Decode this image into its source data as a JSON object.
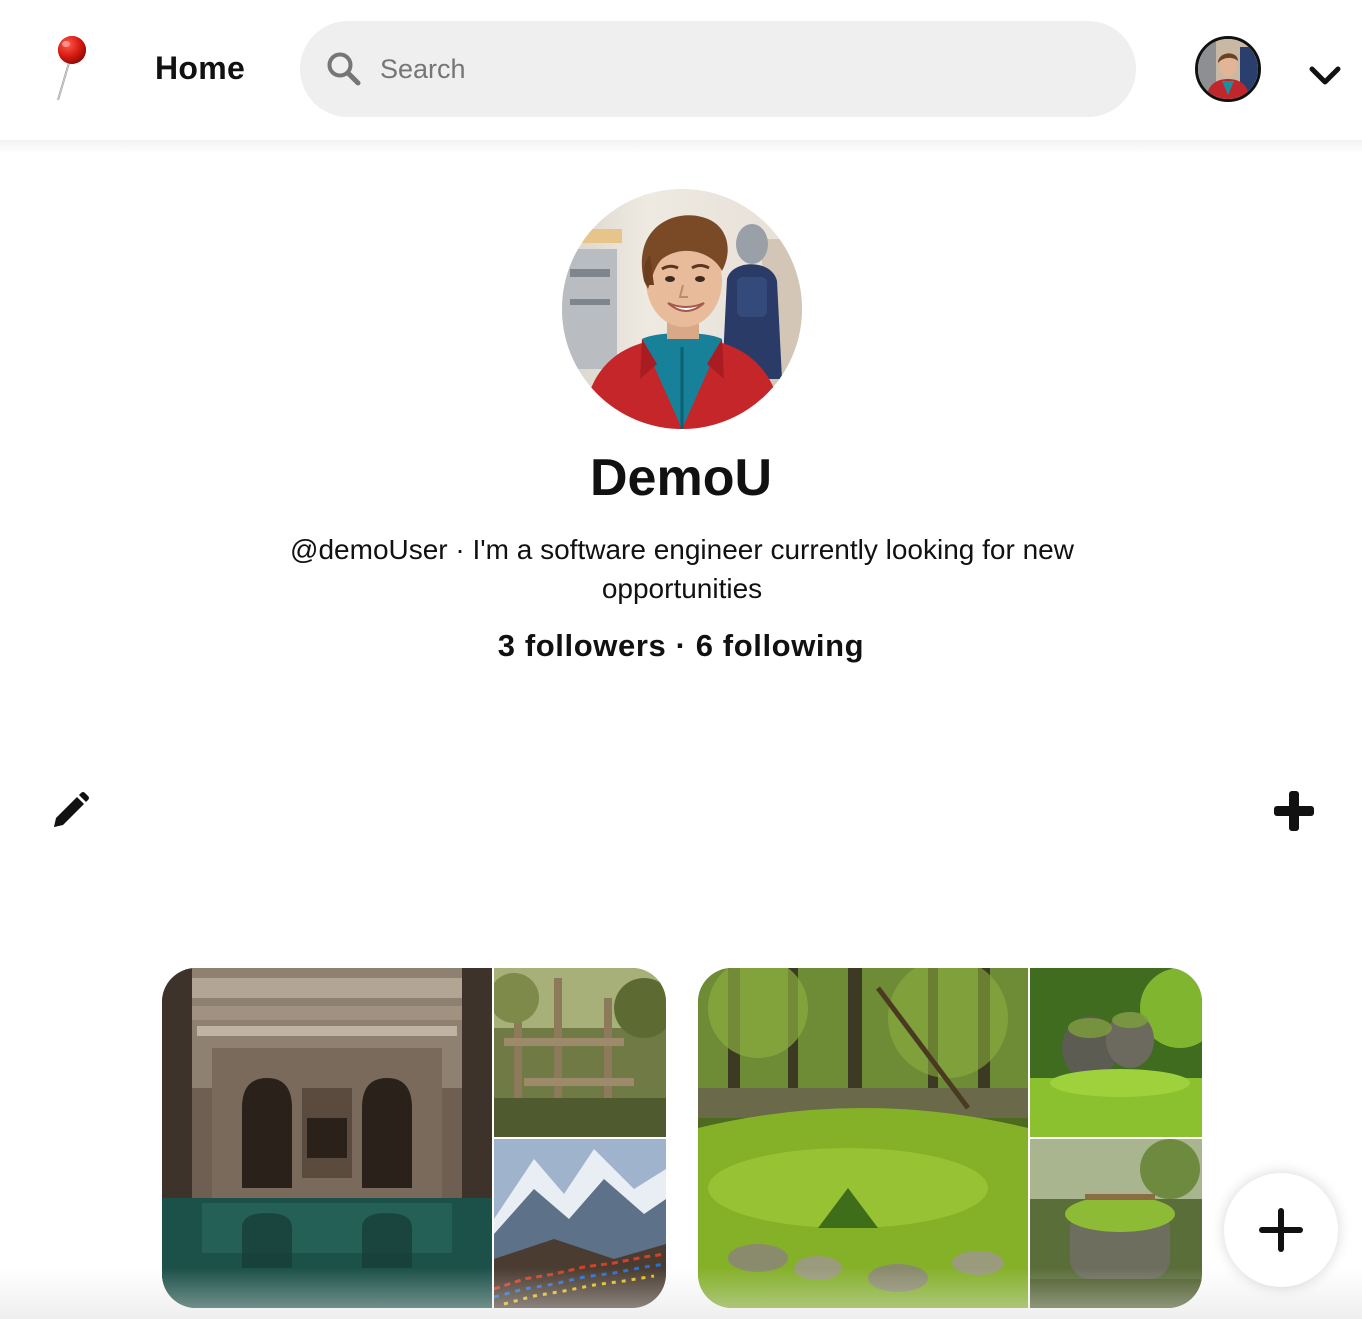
{
  "header": {
    "home_label": "Home",
    "search_placeholder": "Search"
  },
  "profile": {
    "name": "DemoU",
    "username": "@demoUser",
    "separator": "·",
    "bio": "I'm a software engineer currently looking for new opportunities",
    "followers": "3 followers",
    "following": "6 following",
    "stats_separator": "·"
  },
  "icons": {
    "logo": "pushpin-logo-icon",
    "search": "search-icon",
    "chevron": "chevron-down-icon",
    "edit": "pencil-icon",
    "add": "plus-icon",
    "fab": "plus-icon"
  },
  "colors": {
    "search_bg": "#efefef",
    "text": "#111111",
    "placeholder": "#767676",
    "pin_red": "#e0201b"
  }
}
